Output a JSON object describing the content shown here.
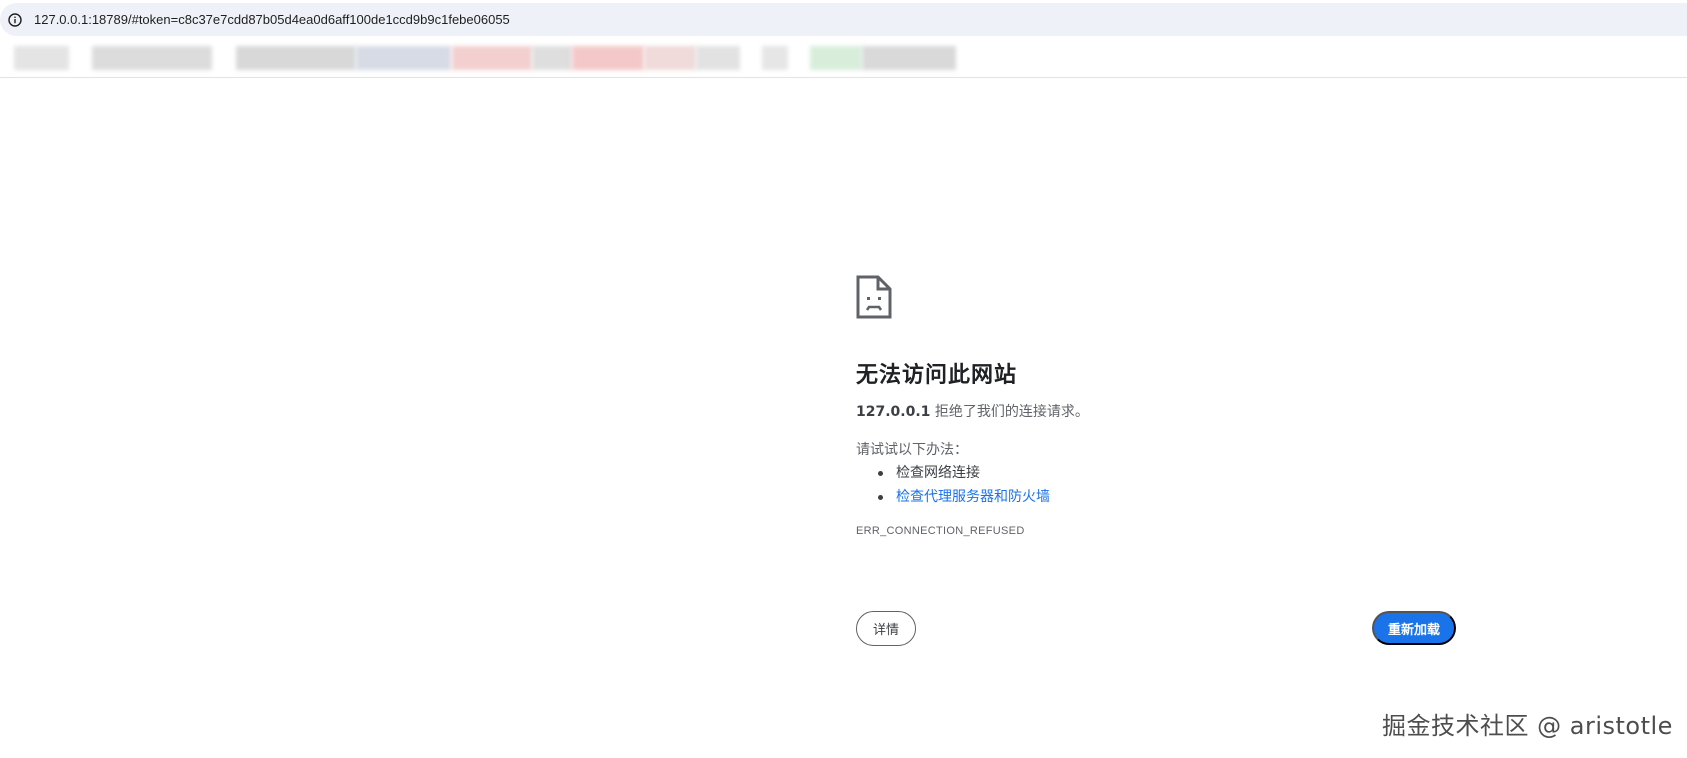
{
  "browser": {
    "url": "127.0.0.1:18789/#token=c8c37e7cdd87b05d4ea0d6aff100de1ccd9b9c1febe06055",
    "info_icon": "info-icon",
    "bookmark_colors": [
      "#d9d9d9",
      "#d0d0d0",
      "#c8c8c8",
      "#cfd6e6",
      "#f1c4c4",
      "#f4c0c0",
      "#cfe9d2",
      "#d6d6d6"
    ]
  },
  "error_page": {
    "icon": "sad-document-icon",
    "title": "无法访问此网站",
    "host": "127.0.0.1",
    "description_rest": " 拒绝了我们的连接请求。",
    "try_label": "请试试以下办法：",
    "suggestions": [
      "检查网络连接",
      "检查代理服务器和防火墙"
    ],
    "error_code": "ERR_CONNECTION_REFUSED",
    "details_button": "详情",
    "reload_button": "重新加载",
    "accent_color": "#1a73e8"
  },
  "watermark": "掘金技术社区 @ aristotle"
}
